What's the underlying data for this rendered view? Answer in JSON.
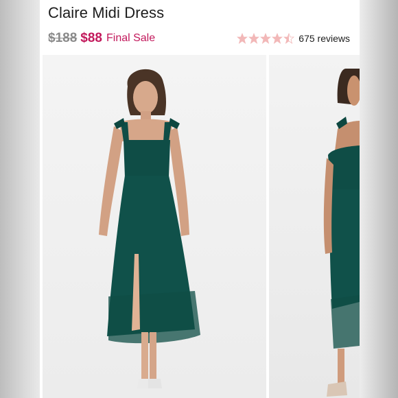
{
  "product": {
    "title": "Claire Midi Dress",
    "price_original": "$188",
    "price_sale": "$88",
    "sale_label": "Final Sale",
    "rating": {
      "stars_filled": 4.5,
      "stars_total": 5,
      "reviews_label": "675 reviews"
    }
  },
  "gallery": {
    "images": [
      {
        "name": "model-front-photo",
        "icon": "photo-model-green-dress"
      },
      {
        "name": "model-side-photo",
        "icon": "photo-model-green-dress"
      }
    ]
  },
  "colors": {
    "sale": "#c2185b",
    "star": "#f2b8b8",
    "dress": "#0f4d46"
  }
}
